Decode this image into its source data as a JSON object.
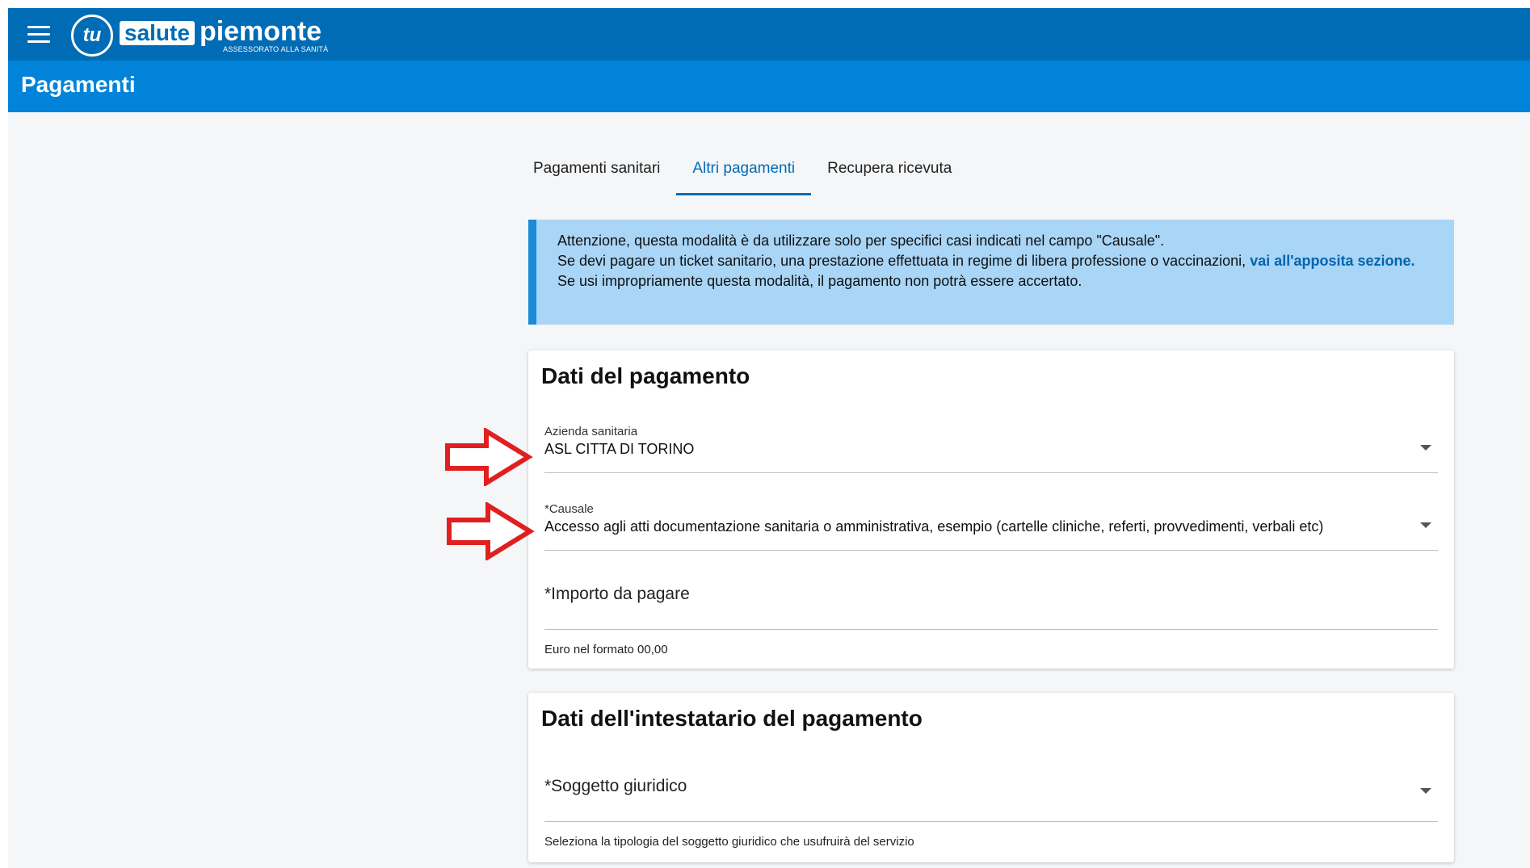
{
  "header": {
    "logo_tu": "tu",
    "logo_salute": "salute",
    "logo_piemonte": "piemonte",
    "logo_sub": "ASSESSORATO ALLA SANITÀ",
    "page_title": "Pagamenti"
  },
  "tabs": [
    {
      "label": "Pagamenti sanitari",
      "active": false
    },
    {
      "label": "Altri pagamenti",
      "active": true
    },
    {
      "label": "Recupera ricevuta",
      "active": false
    }
  ],
  "info": {
    "line1": "Attenzione, questa modalità è da utilizzare solo per specifici casi indicati nel campo \"Causale\".",
    "line2": "Se devi pagare un ticket sanitario, una prestazione effettuata in regime di libera professione o vaccinazioni,",
    "link": "vai all'apposita sezione.",
    "line3": "Se usi impropriamente questa modalità, il pagamento non potrà essere accertato."
  },
  "payment_card": {
    "title": "Dati del pagamento",
    "azienda_label": "Azienda sanitaria",
    "azienda_value": "ASL CITTA DI TORINO",
    "causale_label": "*Causale",
    "causale_value": "Accesso agli atti documentazione sanitaria o amministrativa, esempio (cartelle cliniche, referti, provvedimenti, verbali etc)",
    "importo_label": "*Importo da pagare",
    "importo_hint": "Euro nel formato 00,00"
  },
  "holder_card": {
    "title": "Dati dell'intestatario del pagamento",
    "soggetto_label": "*Soggetto giuridico",
    "soggetto_hint": "Seleziona la tipologia del soggetto giuridico che usufruirà del servizio"
  },
  "colors": {
    "header": "#006cb5",
    "titlebar": "#0083d8",
    "info_bg": "#a9d5f6",
    "annotation_arrow": "#e02020"
  }
}
